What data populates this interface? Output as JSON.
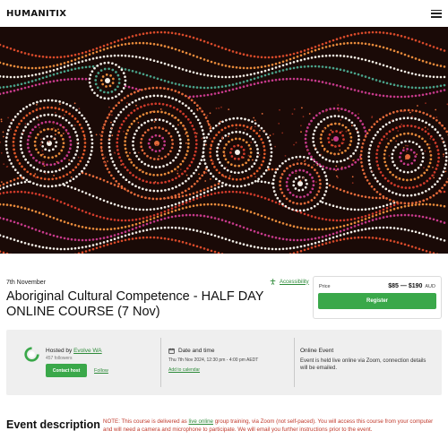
{
  "header": {
    "logo_text": "HUMANITIX",
    "menu_icon": "hamburger-icon"
  },
  "banner": {
    "description_icon": "aboriginal-dot-painting"
  },
  "event": {
    "date": "7th November",
    "title": "Aboriginal Cultural Competence - HALF DAY ONLINE COURSE (7 Nov)",
    "accessibility_label": "Accessibility",
    "accessibility_icon": "accessibility-icon"
  },
  "price_card": {
    "label": "Price",
    "range": "$85 — $190",
    "currency": "AUD",
    "register_label": "Register"
  },
  "host": {
    "hosted_by": "Hosted by",
    "name": "Evolve WA",
    "followers": "457 followers",
    "contact_label": "Contact host",
    "follow_label": "Follow"
  },
  "datetime": {
    "heading": "Date and time",
    "value": "Thu 7th Nov 2024, 12:30 pm - 4:00 pm AEDT",
    "add_calendar_label": "Add to calendar",
    "icon": "calendar-icon"
  },
  "online": {
    "heading": "Online Event",
    "description": "Event is held live online via Zoom, connection details will be emailed."
  },
  "description": {
    "heading": "Event description",
    "note_part1": "NOTE: This course is delivered as ",
    "note_link": "live online",
    "note_part2": " group training, via Zoom (not self-paced). You will access this course from your computer and will need a camera and microphone to participate. We will email you further instructions prior to the event."
  },
  "colors": {
    "accent_green": "#3aa84a",
    "note_red": "#c0392b",
    "info_bg": "#efefef"
  }
}
